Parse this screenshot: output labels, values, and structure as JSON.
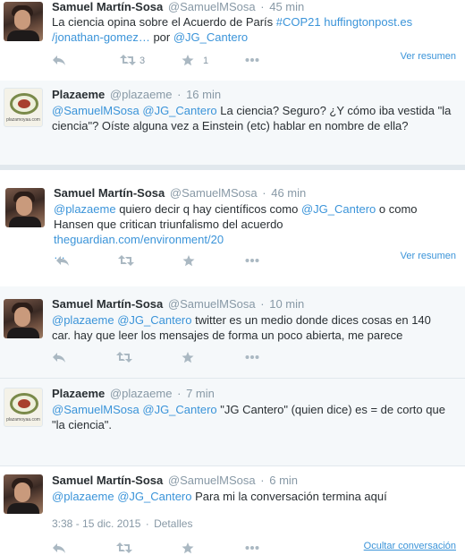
{
  "colors": {
    "link": "#3b94d9",
    "muted": "#8899a6",
    "icon": "#aab8c2",
    "context_bg": "#f5f8fa"
  },
  "tweets": [
    {
      "name": "Samuel Martín-Sosa",
      "handle": "@SamuelMSosa",
      "time": "45 min",
      "text_line1_a": "La ciencia opina sobre el Acuerdo de París ",
      "text_line1_hashtag": "#COP21",
      "text_line1_url": "huffingtonpost.es",
      "text_line2_url": "/jonathan-gomez…",
      "text_line2_by": " por ",
      "text_line2_mention": "@JG_Cantero",
      "retweets": "3",
      "likes": "1",
      "more_link": "Ver resumen"
    },
    {
      "name": "Plazaeme",
      "handle": "@plazaeme",
      "time": "16 min",
      "mention1": "@SamuelMSosa",
      "mention2": "@JG_Cantero",
      "text_line1": " La ciencia? Seguro? ¿Y cómo iba vestida \"la",
      "text_line2": "ciencia\"? Oíste alguna vez a Einstein (etc) hablar en nombre de ella?",
      "logo_text": "plazamoyaa.com"
    },
    {
      "name": "Samuel Martín-Sosa",
      "handle": "@SamuelMSosa",
      "time": "46 min",
      "mention1": "@plazaeme",
      "text_line1_a": " quiero decir q hay científicos como ",
      "mention2": "@JG_Cantero",
      "text_line1_b": " o como",
      "text_line2_a": "Hansen que critican triunfalismo del acuerdo ",
      "text_line2_url": "theguardian.com/environment/20",
      "text_line3": "…",
      "more_link": "Ver resumen"
    },
    {
      "name": "Samuel Martín-Sosa",
      "handle": "@SamuelMSosa",
      "time": "10 min",
      "mention1": "@plazaeme",
      "mention2": "@JG_Cantero",
      "text_line1": " twitter es un medio donde dices cosas en 140",
      "text_line2": "car. hay que leer los mensajes de forma un poco abierta, me parece"
    },
    {
      "name": "Plazaeme",
      "handle": "@plazaeme",
      "time": "7 min",
      "mention1": "@SamuelMSosa",
      "mention2": "@JG_Cantero",
      "text_line1": " \"JG Cantero\" (quien dice) es = de corto que",
      "text_line2": "\"la ciencia\".",
      "logo_text": "plazamoyaa.com"
    },
    {
      "name": "Samuel Martín-Sosa",
      "handle": "@SamuelMSosa",
      "time": "6 min",
      "mention1": "@plazaeme",
      "mention2": "@JG_Cantero",
      "text_line1": " Para mi la conversación termina aquí",
      "timestamp": "3:38 - 15 dic. 2015",
      "details": "Detalles",
      "hide_link": "Ocultar conversación"
    }
  ],
  "icons": [
    "reply-icon",
    "retweet-icon",
    "like-icon",
    "more-icon"
  ]
}
